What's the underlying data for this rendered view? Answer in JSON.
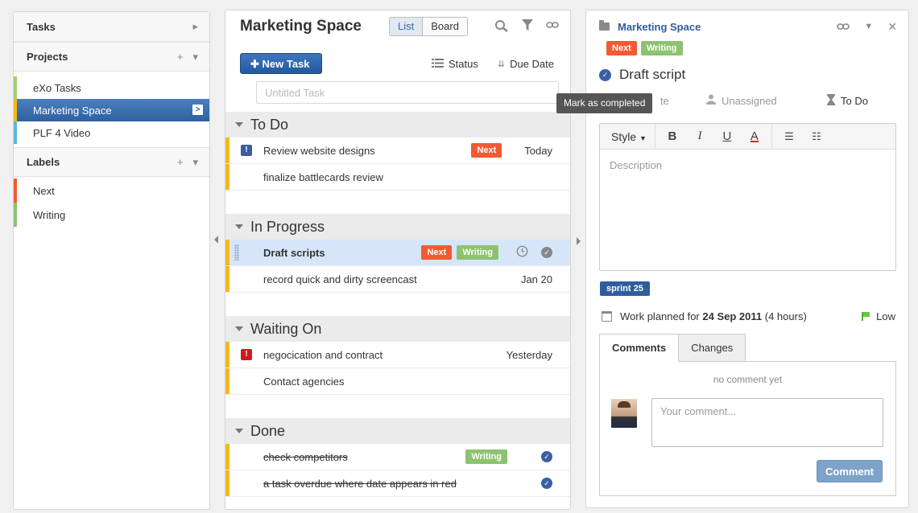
{
  "left": {
    "tasks_label": "Tasks",
    "projects_label": "Projects",
    "projects": [
      {
        "label": "eXo Tasks",
        "color": "#9fcf77"
      },
      {
        "label": "Marketing Space",
        "color": "#f4b81d"
      },
      {
        "label": "PLF 4 Video",
        "color": "#5ab8de"
      }
    ],
    "labels_label": "Labels",
    "labels": [
      {
        "label": "Next",
        "color": "#f25a32"
      },
      {
        "label": "Writing",
        "color": "#8dc26f"
      }
    ]
  },
  "mid": {
    "title": "Marketing Space",
    "view_list": "List",
    "view_board": "Board",
    "new_task": "New Task",
    "sort_status": "Status",
    "sort_due": "Due Date",
    "untitled_placeholder": "Untitled Task",
    "groups": [
      {
        "name": "To Do",
        "tasks": [
          {
            "name": "Review website designs",
            "badge": "Next",
            "date": "Today"
          },
          {
            "name": "finalize battlecards review"
          }
        ]
      },
      {
        "name": "In Progress",
        "tasks": [
          {
            "name": "Draft scripts",
            "badge1": "Next",
            "badge2": "Writing"
          },
          {
            "name": "record quick and dirty screencast",
            "date": "Jan 20"
          }
        ]
      },
      {
        "name": "Waiting On",
        "tasks": [
          {
            "name": "negocication and contract",
            "date": "Yesterday"
          },
          {
            "name": "Contact agencies"
          }
        ]
      },
      {
        "name": "Done",
        "tasks": [
          {
            "name": "check competitors",
            "badge": "Writing"
          },
          {
            "name": "a task overdue where date appears in red"
          }
        ]
      }
    ]
  },
  "right": {
    "project": "Marketing Space",
    "badge_next": "Next",
    "badge_writing": "Writing",
    "task_name": "Draft script",
    "tooltip": "Mark as completed",
    "due_partial": "te",
    "assignee": "Unassigned",
    "status": "To Do",
    "style_label": "Style",
    "description_placeholder": "Description",
    "sprint": "sprint 25",
    "work_prefix": "Work planned for",
    "work_date": "24 Sep 2011",
    "work_hours": "(4 hours)",
    "priority": "Low",
    "tab_comments": "Comments",
    "tab_changes": "Changes",
    "no_comment": "no comment yet",
    "comment_placeholder": "Your comment...",
    "comment_button": "Comment"
  }
}
